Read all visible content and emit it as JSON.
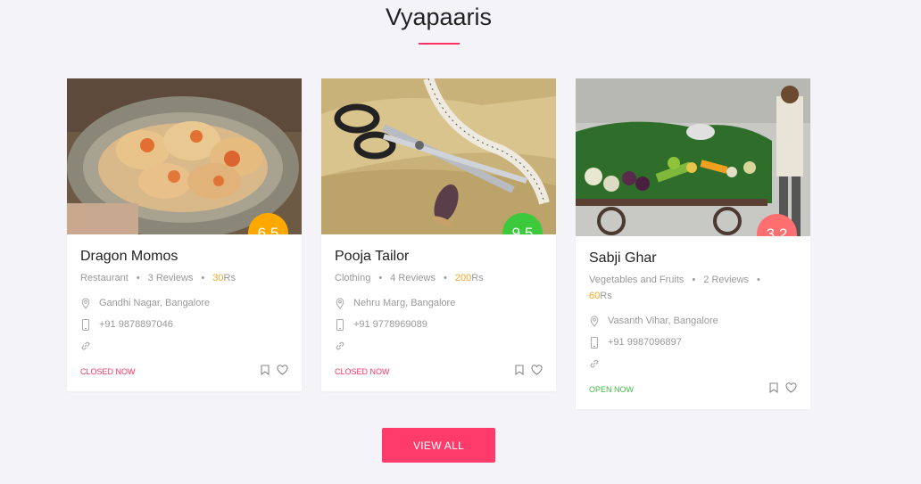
{
  "section": {
    "title": "Vyapaaris"
  },
  "colors": {
    "accent": "#ff3366",
    "closed": "#ff3366",
    "open": "#44bb44",
    "price": "#f5a623"
  },
  "cards": [
    {
      "name": "Dragon Momos",
      "category": "Restaurant",
      "reviews": "3 Reviews",
      "price": "30",
      "price_unit": "Rs",
      "rating": "6.5",
      "rating_color": "#ffa900",
      "address": "Gandhi Nagar, Bangalore",
      "phone": "+91 9878897046",
      "status": "CLOSED NOW",
      "image": "momos-photo"
    },
    {
      "name": "Pooja Tailor",
      "category": "Clothing",
      "reviews": "4 Reviews",
      "price": "200",
      "price_unit": "Rs",
      "rating": "9.5",
      "rating_color": "#3cc93c",
      "address": "Nehru Marg, Bangalore",
      "phone": "+91 9778969089",
      "status": "CLOSED NOW",
      "image": "tailor-photo"
    },
    {
      "name": "Sabji Ghar",
      "category": "Vegetables and Fruits",
      "reviews": "2 Reviews",
      "price": "60",
      "price_unit": "Rs",
      "rating": "3.2",
      "rating_color": "#ff6f6f",
      "address": "Vasanth Vihar, Bangalore",
      "phone": "+91 9987096897",
      "status": "OPEN NOW",
      "image": "vegetables-photo"
    }
  ],
  "icons": [
    "map-pin-icon",
    "phone-icon",
    "link-icon",
    "bookmark-icon",
    "heart-icon"
  ],
  "view_all_label": "VIEW ALL"
}
